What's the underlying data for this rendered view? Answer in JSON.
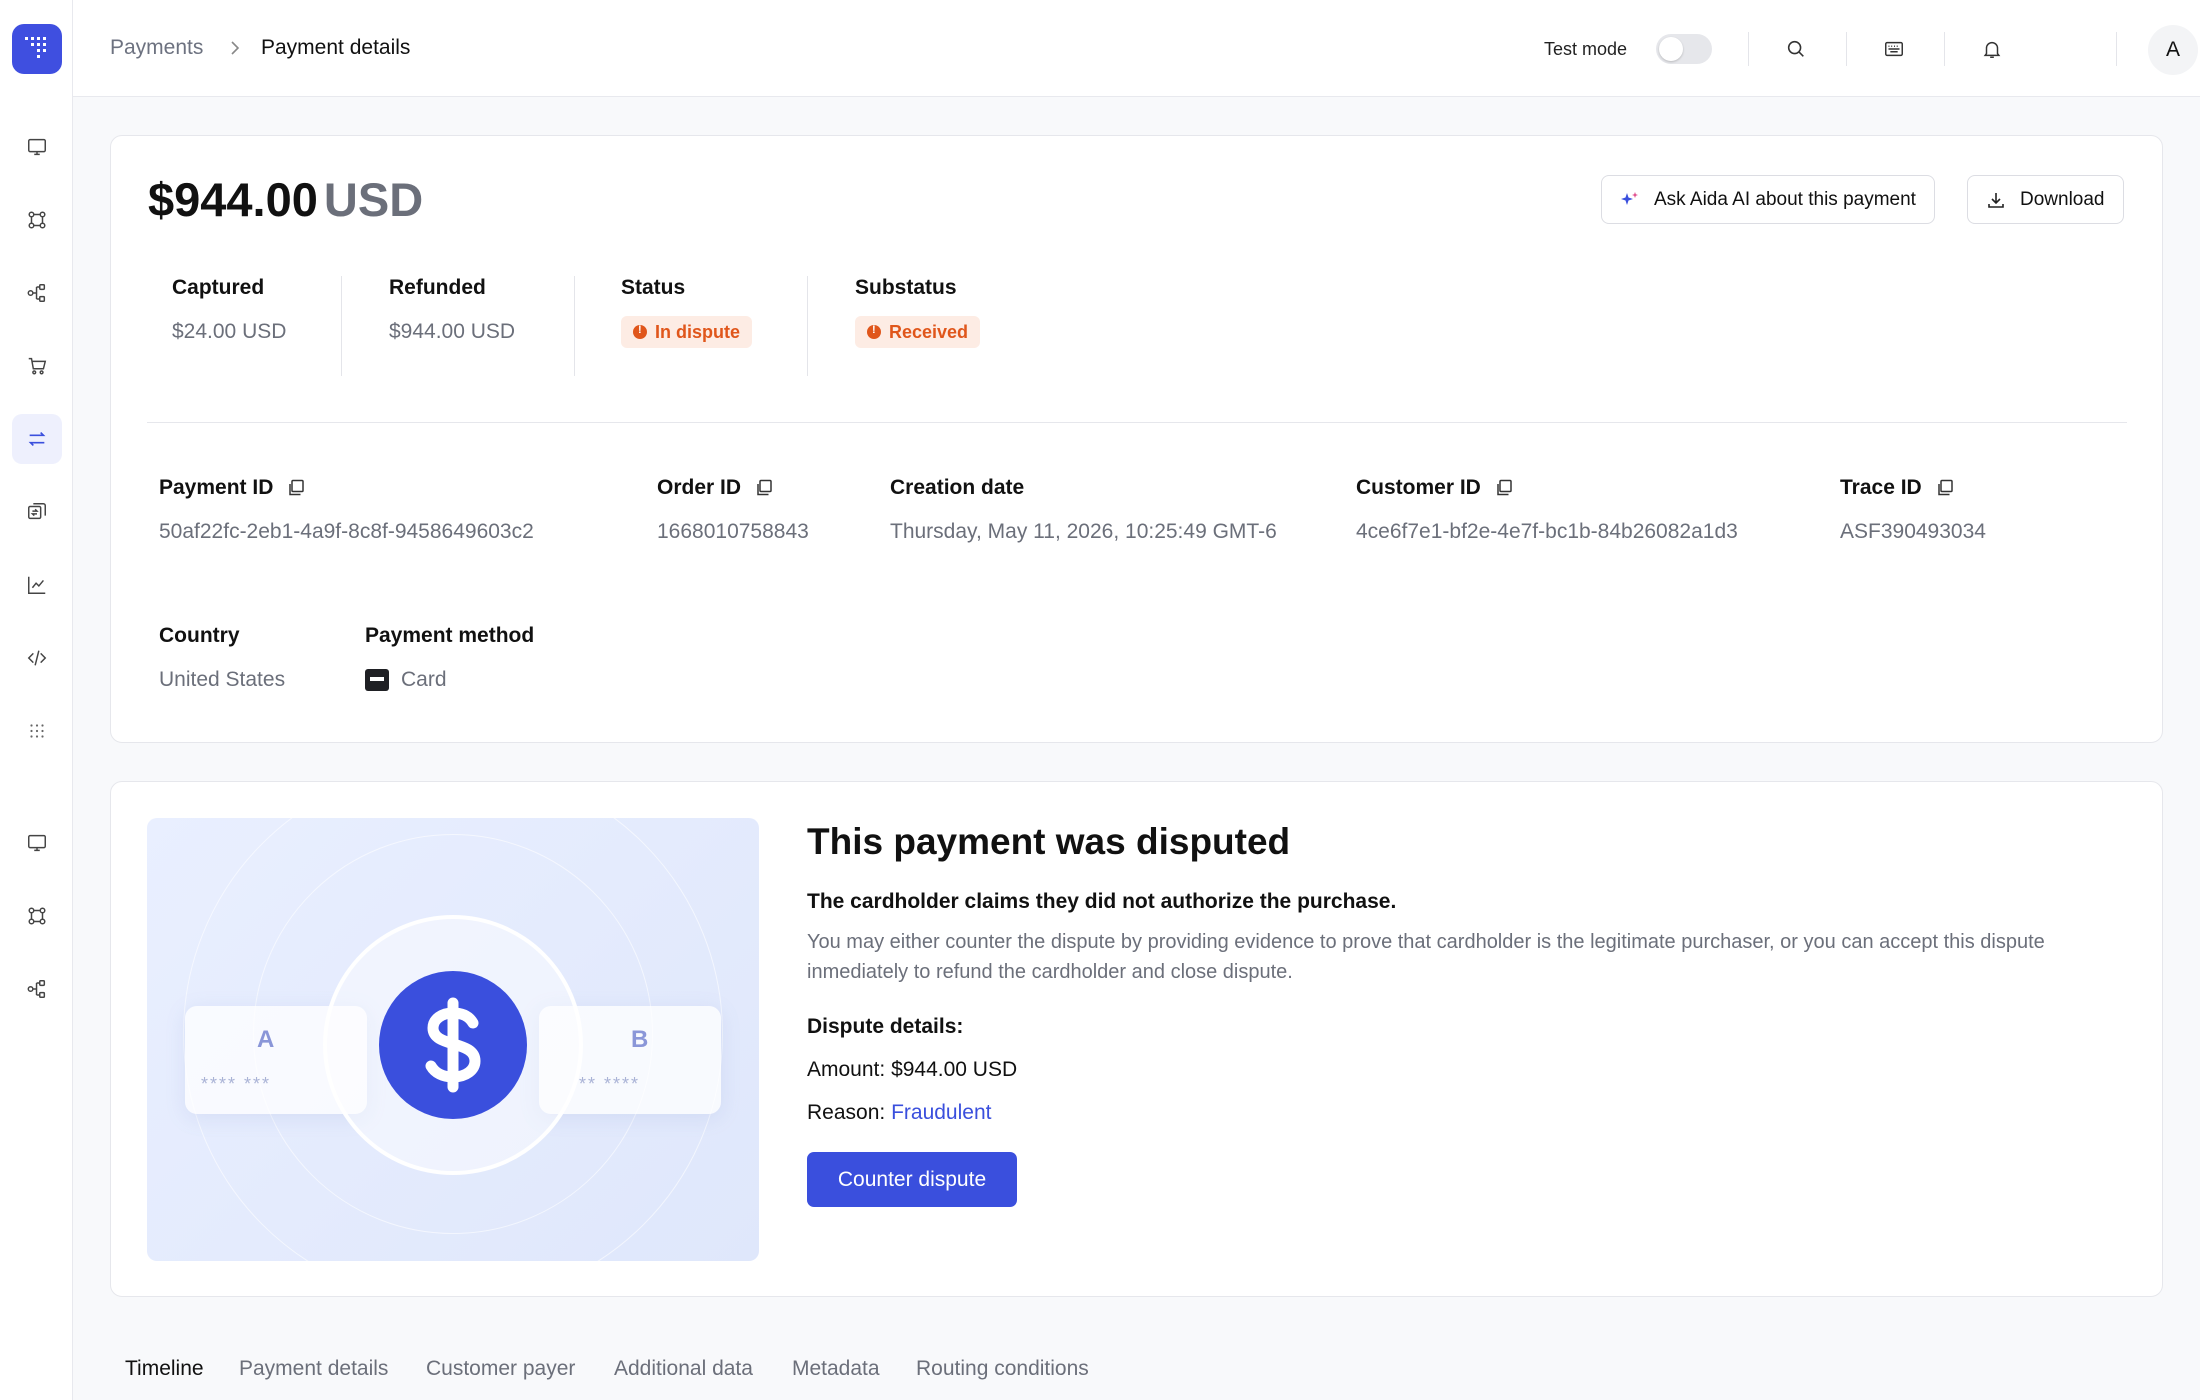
{
  "sidebar": {
    "logo_icon": "grid-logo-icon",
    "items": [
      {
        "icon": "monitor-icon"
      },
      {
        "icon": "workflow-icon"
      },
      {
        "icon": "connections-icon"
      },
      {
        "icon": "cart-icon"
      },
      {
        "icon": "transactions-icon",
        "active": true
      },
      {
        "icon": "reconciliation-icon"
      },
      {
        "icon": "chart-icon"
      },
      {
        "icon": "code-icon"
      },
      {
        "icon": "apps-grid-icon"
      },
      {
        "icon": "monitor-icon"
      },
      {
        "icon": "workflow-icon"
      },
      {
        "icon": "connections-icon"
      }
    ]
  },
  "header": {
    "breadcrumb": [
      "Payments",
      "Payment details"
    ],
    "test_mode_label": "Test mode",
    "test_mode_on": false,
    "avatar_initial": "A"
  },
  "payment": {
    "amount": "$944.00",
    "currency": "USD",
    "ask_ai_label": "Ask Aida AI about this payment",
    "download_label": "Download",
    "stats": {
      "captured_label": "Captured",
      "captured_value": "$24.00 USD",
      "refunded_label": "Refunded",
      "refunded_value": "$944.00 USD",
      "status_label": "Status",
      "status_value": "In dispute",
      "substatus_label": "Substatus",
      "substatus_value": "Received"
    },
    "fields": {
      "payment_id_label": "Payment ID",
      "payment_id": "50af22fc-2eb1-4a9f-8c8f-9458649603c2",
      "order_id_label": "Order ID",
      "order_id": "1668010758843",
      "creation_date_label": "Creation date",
      "creation_date": "Thursday, May 11, 2026, 10:25:49 GMT-6",
      "customer_id_label": "Customer ID",
      "customer_id": "4ce6f7e1-bf2e-4e7f-bc1b-84b26082a1d3",
      "trace_id_label": "Trace ID",
      "trace_id": "ASF390493034",
      "country_label": "Country",
      "country": "United States",
      "payment_method_label": "Payment method",
      "payment_method": "Card"
    }
  },
  "dispute": {
    "illustration": {
      "card_a_letter": "A",
      "card_b_letter": "B",
      "card_a_stars": "**** ***",
      "card_b_stars": "** ****"
    },
    "title": "This payment was disputed",
    "subtitle": "The cardholder claims they did not authorize the purchase.",
    "description": "You may either counter the dispute by providing evidence to prove that cardholder is the legitimate purchaser, or you can accept this dispute inmediately to refund the cardholder and close dispute.",
    "details_heading": "Dispute details:",
    "amount_label": "Amount:",
    "amount_value": "$944.00 USD",
    "reason_label": "Reason:",
    "reason_value": "Fraudulent",
    "counter_button": "Counter dispute"
  },
  "tabs": [
    "Timeline",
    "Payment details",
    "Customer payer",
    "Additional data",
    "Metadata",
    "Routing conditions"
  ],
  "colors": {
    "accent": "#3a4fdd",
    "status_orange": "#e0561b",
    "status_bg": "#fdece4"
  }
}
